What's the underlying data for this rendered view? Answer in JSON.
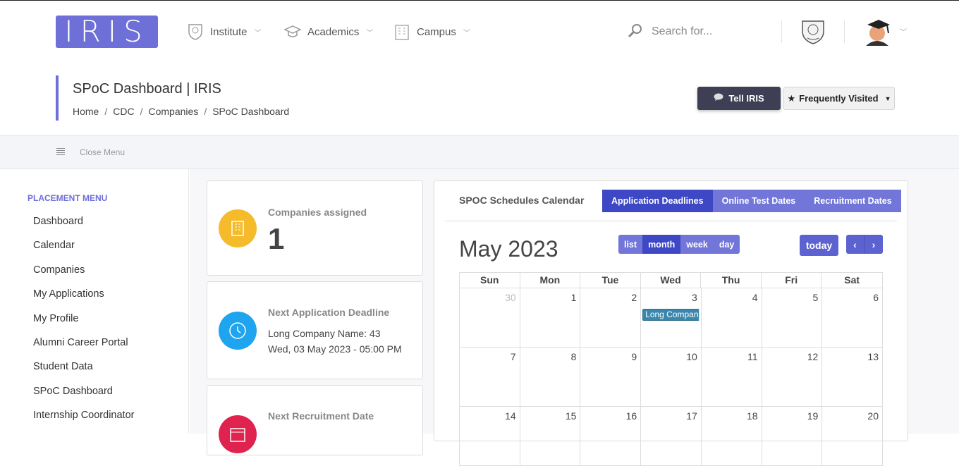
{
  "logo": {
    "text": "IRIS"
  },
  "nav": {
    "items": [
      {
        "label": "Institute",
        "icon": "emblem-icon"
      },
      {
        "label": "Academics",
        "icon": "graduation-cap-icon"
      },
      {
        "label": "Campus",
        "icon": "building-icon"
      }
    ],
    "search_placeholder": "Search for..."
  },
  "header": {
    "title": "SPoC Dashboard | IRIS",
    "breadcrumb": [
      "Home",
      "CDC",
      "Companies",
      "SPoC Dashboard"
    ],
    "tell_iris_label": "Tell IRIS",
    "freq_visited_label": "Frequently Visited"
  },
  "menubar": {
    "close_menu_label": "Close Menu"
  },
  "sidebar": {
    "heading": "PLACEMENT MENU",
    "items": [
      "Dashboard",
      "Calendar",
      "Companies",
      "My Applications",
      "My Profile",
      "Alumni Career Portal",
      "Student Data",
      "SPoC Dashboard",
      "Internship Coordinator"
    ]
  },
  "cards": {
    "companies": {
      "label": "Companies assigned",
      "value": "1",
      "color": "#f6bb2a"
    },
    "deadline": {
      "label": "Next Application Deadline",
      "line1": "Long Company Name: 43",
      "line2": "Wed, 03 May 2023 - 05:00 PM",
      "color": "#1fa4f0"
    },
    "recruitment": {
      "label": "Next Recruitment Date",
      "color": "#e0234e"
    }
  },
  "calendar": {
    "title": "SPOC Schedules Calendar",
    "tabs": [
      "Application Deadlines",
      "Online Test Dates",
      "Recruitment Dates"
    ],
    "month_title": "May 2023",
    "views": [
      "list",
      "month",
      "week",
      "day"
    ],
    "today_label": "today",
    "prev": "‹",
    "next": "›",
    "days": [
      "Sun",
      "Mon",
      "Tue",
      "Wed",
      "Thu",
      "Fri",
      "Sat"
    ],
    "weeks": [
      [
        "30",
        "1",
        "2",
        "3",
        "4",
        "5",
        "6"
      ],
      [
        "7",
        "8",
        "9",
        "10",
        "11",
        "12",
        "13"
      ],
      [
        "14",
        "15",
        "16",
        "17",
        "18",
        "19",
        "20"
      ]
    ],
    "event_label": "Long Compan"
  },
  "colors": {
    "primary": "#6f6fd8",
    "tab_active": "#3f48c4",
    "tab": "#7176d8",
    "event": "#3a87ad"
  }
}
